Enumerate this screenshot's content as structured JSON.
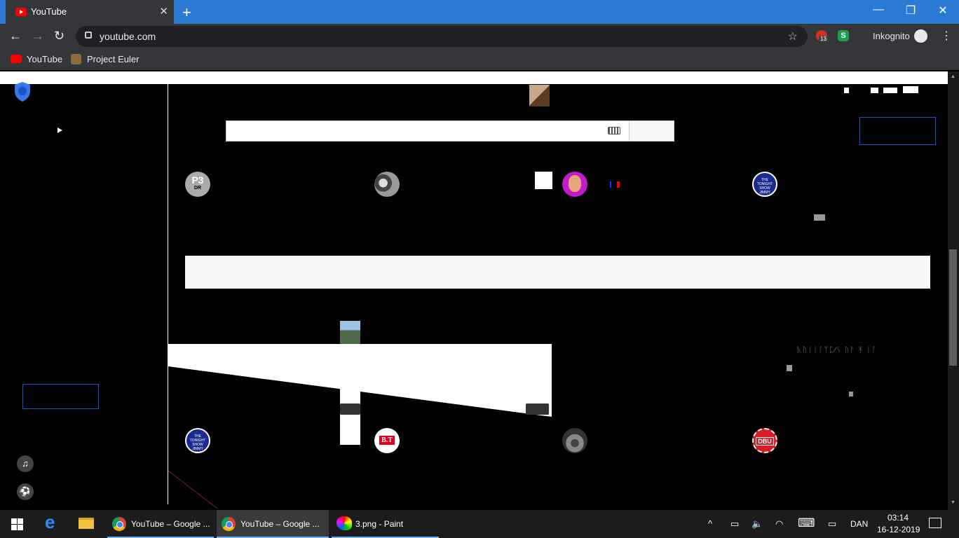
{
  "browser": {
    "tab_title": "YouTube",
    "tab_close": "✕",
    "new_tab": "+",
    "window_controls": {
      "minimize": "—",
      "restore": "❐",
      "close": "✕"
    },
    "nav": {
      "back": "←",
      "forward": "→",
      "reload": "↻"
    },
    "url": "youtube.com",
    "star": "☆",
    "extension_badge": "13",
    "extension2_label": "S",
    "incognito_label": "Inkognito",
    "menu": "⋮",
    "bookmarks": [
      {
        "label": "YouTube",
        "icon": "youtube-icon",
        "color": "#ff0000"
      },
      {
        "label": "Project Euler",
        "icon": "project-euler-icon",
        "color": "#8a6d3b"
      }
    ]
  },
  "page": {
    "search": {
      "value": "",
      "placeholder": ""
    },
    "avatars_row1": [
      {
        "name": "p3-dr",
        "text1": "P3",
        "text2": "DR"
      },
      {
        "name": "duo",
        "text1": ""
      },
      {
        "name": "man",
        "text1": ""
      },
      {
        "name": "tonight-show-1",
        "text1": "THE TONIGHT SHOW JIMMY FALLON"
      }
    ],
    "avatars_row2": [
      {
        "name": "tonight-show-2",
        "text1": "THE TONIGHT SHOW JIMMY FALLON"
      },
      {
        "name": "bt",
        "text1": "B.T"
      },
      {
        "name": "tree",
        "text1": ""
      },
      {
        "name": "dbu",
        "text1": "DBU"
      }
    ],
    "glitch_text": "ᚣᚢᛁᛁᛚᛉᛈ⁄ᛊ ᚢᚨ ᛡ ᛁᛚ",
    "side_icons": {
      "music": "♫",
      "ball": "⚽"
    }
  },
  "taskbar": {
    "tasks": [
      {
        "label": "YouTube – Google ...",
        "icon": "chrome-icon",
        "active": false
      },
      {
        "label": "YouTube – Google ...",
        "icon": "chrome-icon",
        "active": true
      },
      {
        "label": "3.png - Paint",
        "icon": "paint-icon",
        "active": false
      }
    ],
    "tray": {
      "chevron": "^",
      "battery": "▭",
      "volume": "🔈",
      "wifi": "◠",
      "keyboard": "⌨",
      "display": "▭"
    },
    "language": "DAN",
    "time": "03:14",
    "date": "16-12-2019"
  },
  "colors": {
    "titlebar": "#2b7bd4",
    "chrome_dark": "#35363a",
    "page_bg": "#000000",
    "focus_border": "#1a56c9"
  }
}
